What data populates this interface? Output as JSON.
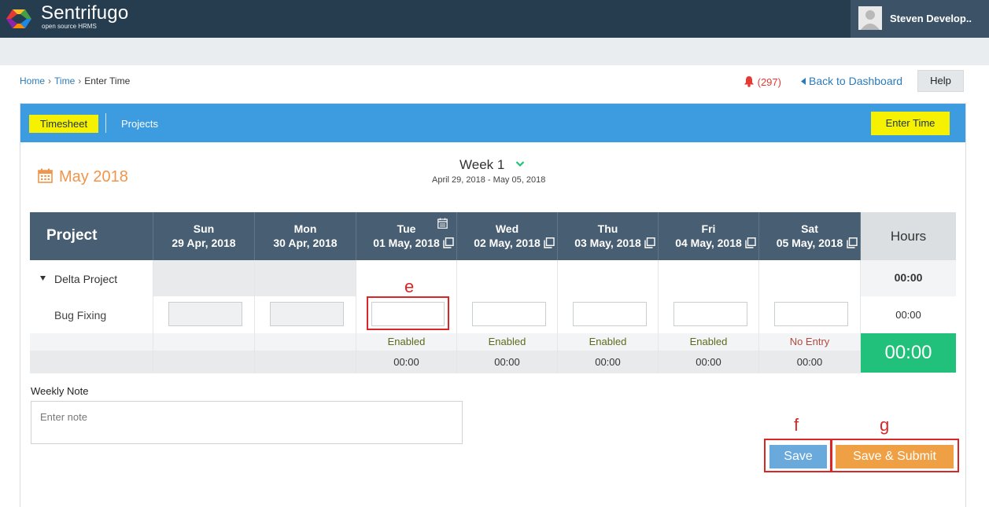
{
  "app": {
    "name": "Sentrifugo",
    "tagline": "open source HRMS"
  },
  "user": {
    "name": "Steven Develop.."
  },
  "breadcrumb": {
    "home": "Home",
    "time": "Time",
    "current": "Enter Time",
    "sep": "›"
  },
  "header": {
    "notifications": "(297)",
    "back_to_dashboard": "Back to Dashboard",
    "help": "Help"
  },
  "tabs": {
    "timesheet": "Timesheet",
    "projects": "Projects",
    "enter_time": "Enter Time"
  },
  "period": {
    "month": "May 2018",
    "week": "Week 1",
    "range": "April 29, 2018 - May 05, 2018"
  },
  "grid": {
    "project_header": "Project",
    "hours_header": "Hours",
    "days": [
      {
        "day": "Sun",
        "date": "29 Apr, 2018"
      },
      {
        "day": "Mon",
        "date": "30 Apr, 2018"
      },
      {
        "day": "Tue",
        "date": "01 May, 2018"
      },
      {
        "day": "Wed",
        "date": "02 May, 2018"
      },
      {
        "day": "Thu",
        "date": "03 May, 2018"
      },
      {
        "day": "Fri",
        "date": "04 May, 2018"
      },
      {
        "day": "Sat",
        "date": "05 May, 2018"
      }
    ],
    "project": {
      "name": "Delta Project",
      "hours": "00:00"
    },
    "task": {
      "name": "Bug Fixing",
      "hours": "00:00"
    },
    "status": [
      "Enabled",
      "Enabled",
      "Enabled",
      "Enabled",
      "No Entry"
    ],
    "day_totals": [
      "00:00",
      "00:00",
      "00:00",
      "00:00",
      "00:00"
    ],
    "grand_total": "00:00"
  },
  "note": {
    "label": "Weekly Note",
    "placeholder": "Enter note"
  },
  "actions": {
    "save": "Save",
    "save_submit": "Save & Submit"
  },
  "annotations": {
    "e": "e",
    "f": "f",
    "g": "g"
  },
  "colors": {
    "topbar": "#263d50",
    "panel_header": "#3d9be0",
    "highlight_yellow": "#f6f100",
    "grid_header": "#485e73",
    "total_green": "#22c17b",
    "save_blue": "#6aa9db",
    "submit_orange": "#f0a044",
    "month_orange": "#f0954a",
    "annotation_red": "#d92626"
  }
}
